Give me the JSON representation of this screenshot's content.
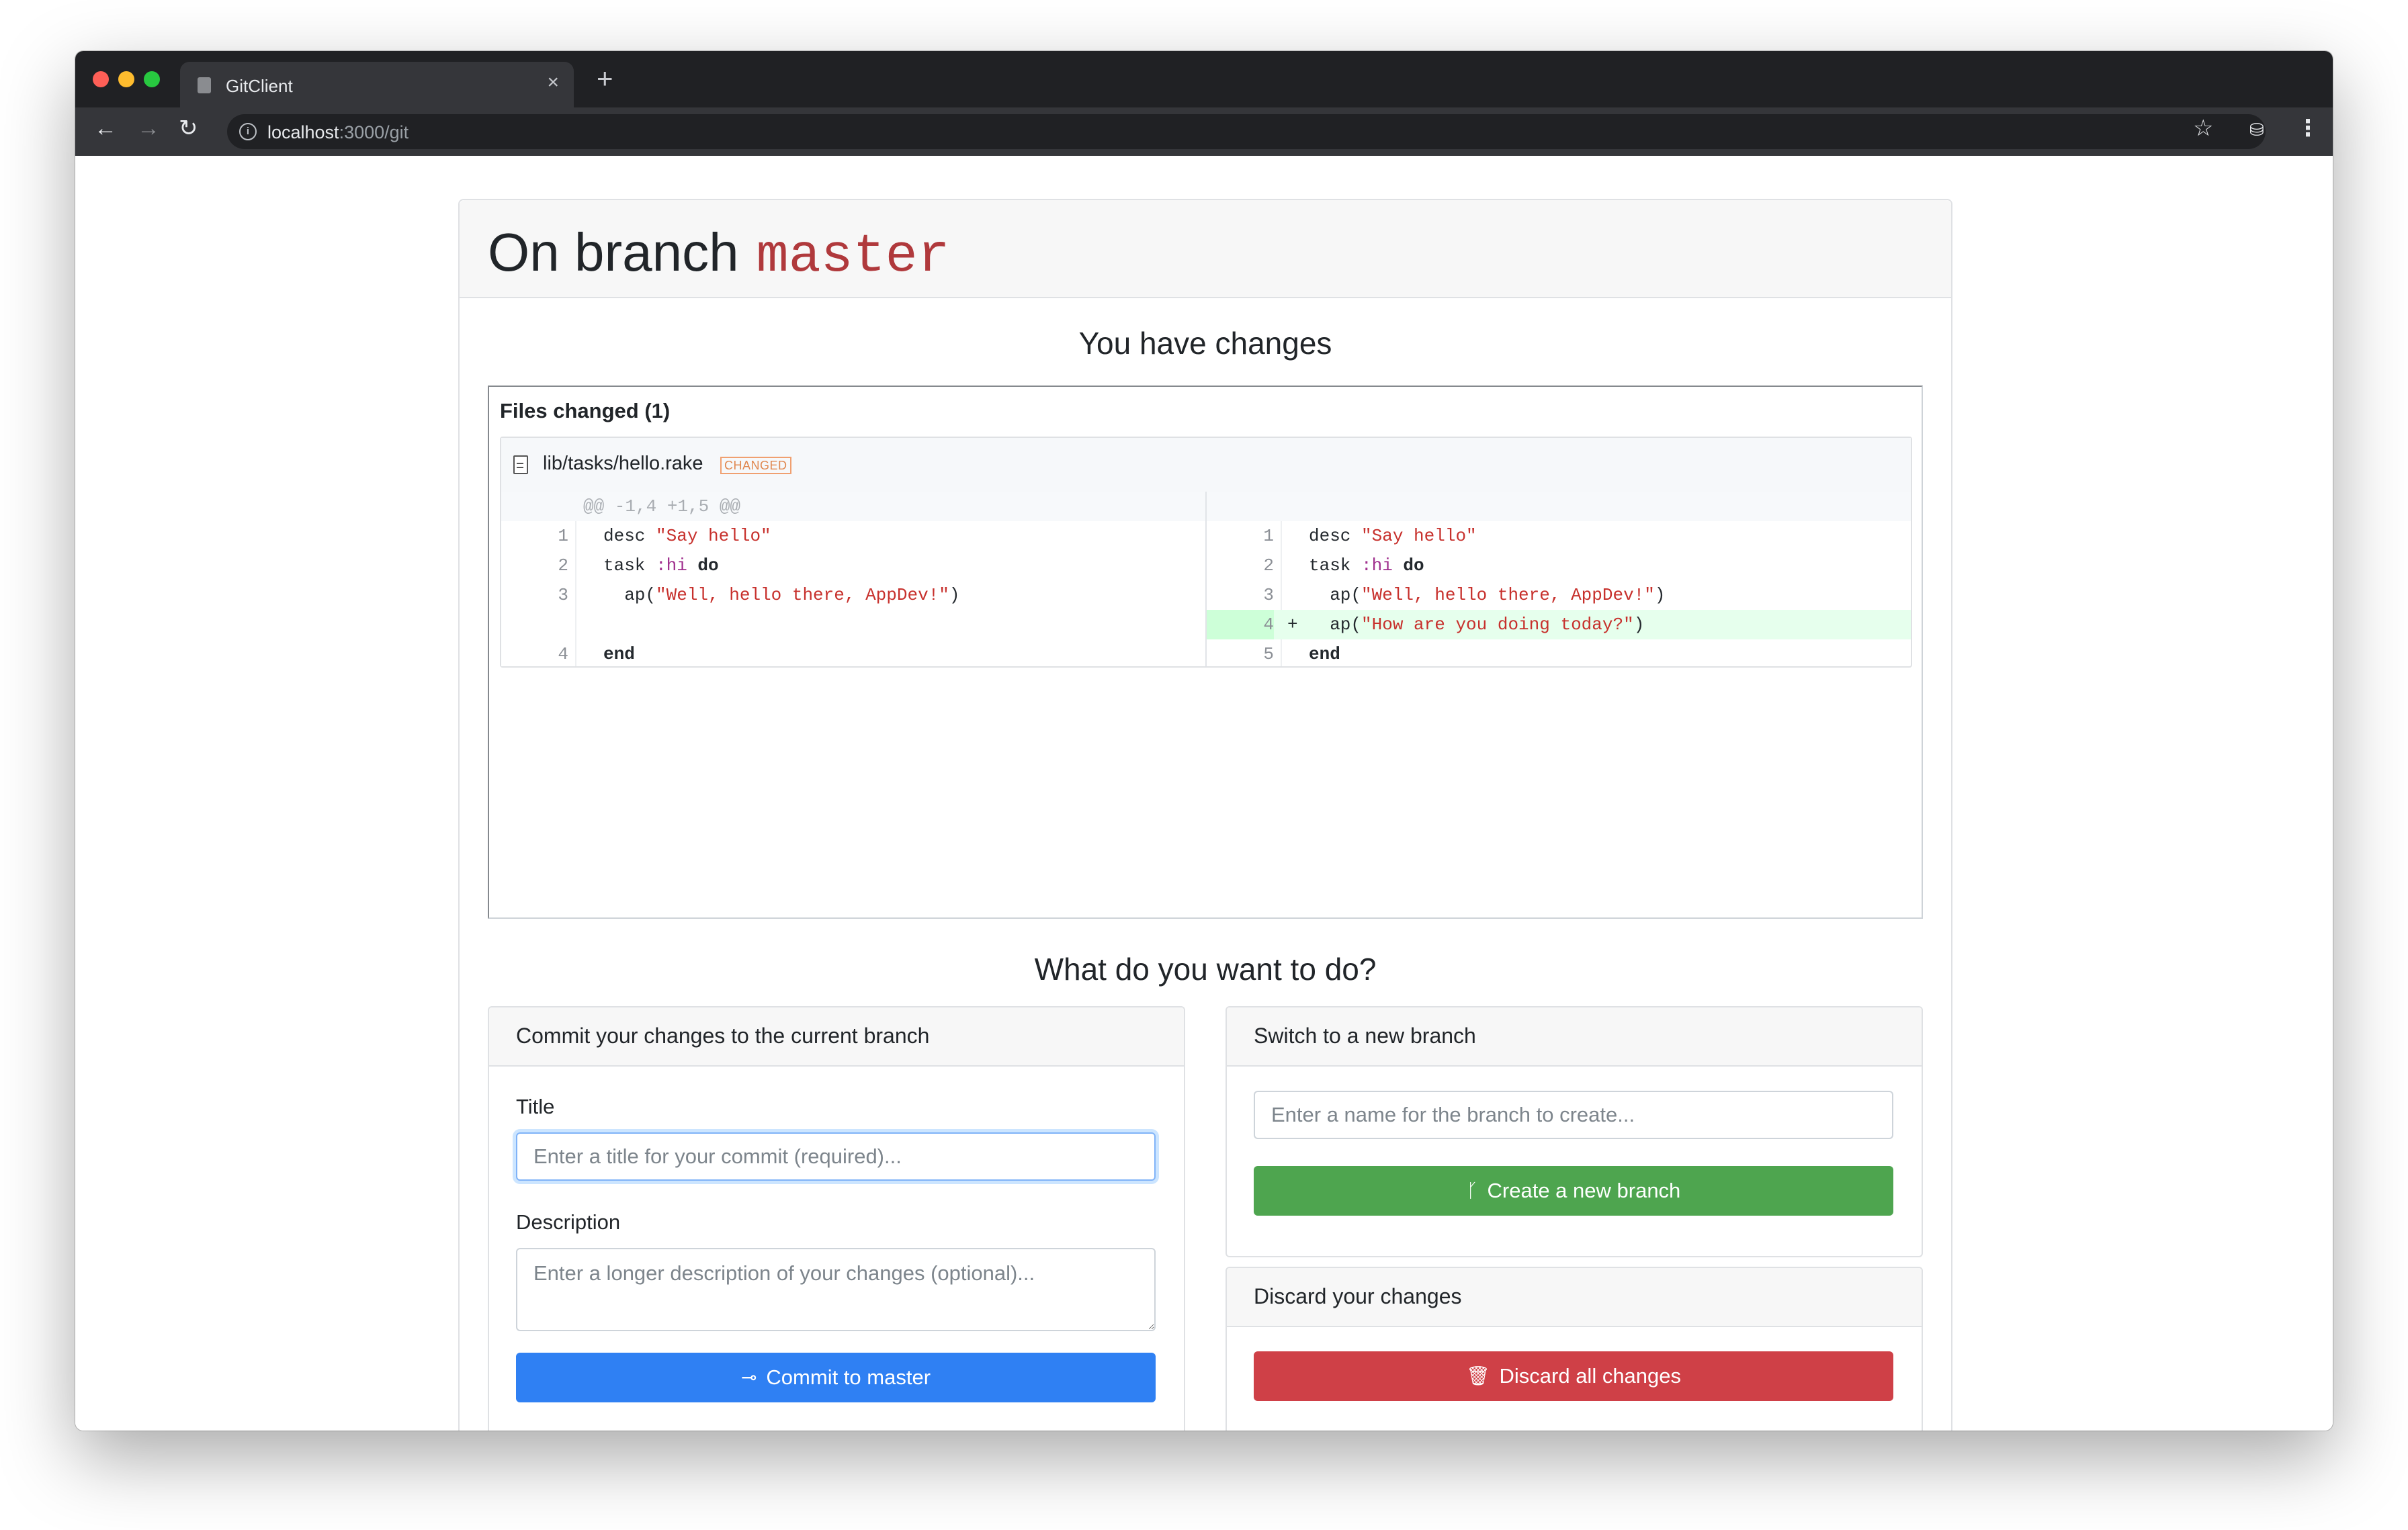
{
  "browser": {
    "tab_title": "GitClient",
    "tab_close": "×",
    "new_tab": "+",
    "url_host": "localhost",
    "url_path": ":3000/git"
  },
  "page": {
    "heading_prefix": "On branch",
    "branch": "master",
    "changes_heading": "You have changes",
    "todo_heading": "What do you want to do?"
  },
  "files": {
    "label": "Files changed (1)",
    "file_name": "lib/tasks/hello.rake",
    "file_status": "CHANGED",
    "hunk_header": "@@ -1,4 +1,5 @@",
    "left_lines": [
      {
        "num": "1",
        "kind": "ctx"
      },
      {
        "num": "2",
        "kind": "ctx"
      },
      {
        "num": "3",
        "kind": "ctx"
      },
      {
        "num": "",
        "kind": "empty"
      },
      {
        "num": "4",
        "kind": "ctx"
      }
    ],
    "right_lines": [
      {
        "num": "1",
        "kind": "ctx"
      },
      {
        "num": "2",
        "kind": "ctx"
      },
      {
        "num": "3",
        "kind": "ctx"
      },
      {
        "num": "4",
        "kind": "add",
        "sign": "+"
      },
      {
        "num": "5",
        "kind": "ctx"
      }
    ],
    "code": {
      "desc_kw": "desc ",
      "desc_str": "\"Say hello\"",
      "task_kw": "task ",
      "task_sym": ":hi",
      "do_kw": " do",
      "ap_open": "  ap(",
      "ap_str_1": "\"Well, hello there, AppDev!\"",
      "ap_close": ")",
      "ap_str_2": "\"How are you doing today?\"",
      "end_kw": "end"
    }
  },
  "commit_panel": {
    "title": "Commit your changes to the current branch",
    "title_label": "Title",
    "title_placeholder": "Enter a title for your commit (required)...",
    "description_label": "Description",
    "description_placeholder": "Enter a longer description of your changes (optional)...",
    "button_label": "Commit to master",
    "button_icon": "commit-icon"
  },
  "switch_panel": {
    "title": "Switch to a new branch",
    "placeholder": "Enter a name for the branch to create...",
    "button_label": "Create a new branch",
    "button_icon": "git-branch-icon"
  },
  "discard_panel": {
    "title": "Discard your changes",
    "button_label": "Discard all changes",
    "button_icon": "trash-icon"
  },
  "colors": {
    "primary": "#2f80f3",
    "success": "#4ea54f",
    "danger": "#cf4047",
    "branch_code": "#b0393c",
    "added_line": "#e6ffed"
  }
}
